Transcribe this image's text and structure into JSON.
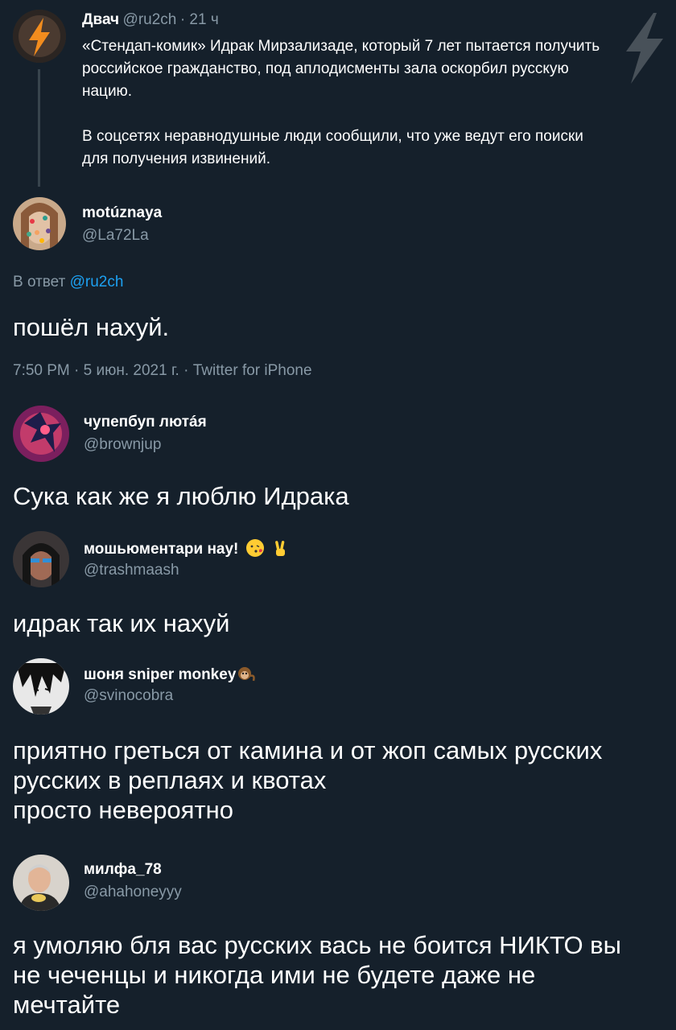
{
  "original_tweet": {
    "author_name": "Двач",
    "author_handle": "@ru2ch",
    "time_ago": "· 21 ч",
    "text_p1_l1": "«Стендап-комик» Идрак Мирзализаде, который 7 лет пытается получить",
    "text_p1_l2": "российское гражданство, под аплодисменты зала оскорбил русскую",
    "text_p1_l3": "нацию.",
    "text_p2_l1": "В соцсетях неравнодушные люди сообщили, что уже ведут его поиски",
    "text_p2_l2": "для получения извинений."
  },
  "main_reply": {
    "author_name": "motúznaya",
    "author_handle": "@La72La",
    "reply_to_prefix": "В ответ",
    "reply_to_handle": "@ru2ch",
    "text": "пошёл нахуй.",
    "meta": "7:50 PM · 5 июн. 2021 г. · Twitter for iPhone"
  },
  "replies": [
    {
      "author_name": "чупепбуп лютáя",
      "author_handle": "@brownjup",
      "text_l1": "Сука как же я люблю Идрака"
    },
    {
      "author_name": "мошьюментари нау!",
      "author_handle": "@trashmaash",
      "emojis": [
        "kiss-face-emoji",
        "victory-hand-emoji"
      ],
      "text_l1": "идрак так их нахуй"
    },
    {
      "author_name": "шоня sniper monkey",
      "author_handle": "@svinocobra",
      "emojis": [
        "monkey-emoji"
      ],
      "text_l1": "приятно греться от камина и от жоп самых русских",
      "text_l2": "русских в реплаях и квотах",
      "text_l3": "просто невероятно"
    },
    {
      "author_name": "милфа_78",
      "author_handle": "@ahahoneyyy",
      "text_l1": "я умоляю бля вас русских вась не боится НИКТО вы",
      "text_l2": "не чеченцы и никогда ими не будете даже не",
      "text_l3": "мечтайте"
    }
  ],
  "colors": {
    "background": "#15202b",
    "text": "#ffffff",
    "muted": "#8899a6",
    "link": "#1da1f2",
    "thread_line": "#38444d"
  }
}
